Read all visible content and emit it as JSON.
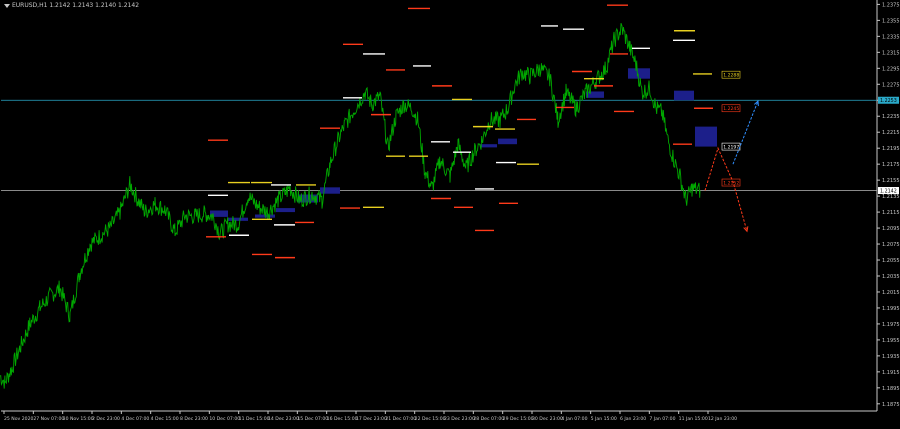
{
  "window": {
    "symbol_header": "EURUSD,H1  1.2142 1.2143 1.2140 1.2142"
  },
  "colors": {
    "background": "#000000",
    "price_line": "#00a800",
    "axis_text": "#c8c8c8",
    "axis_border": "#c8c8c8",
    "hline": "#2aa9c9",
    "zone": "#1c1f8a",
    "level_red": "#ff3a1a",
    "level_white": "#ffffff",
    "level_yellow": "#e8d020",
    "arrow_blue": "#2f8fff",
    "arrow_red": "#ff3030"
  },
  "chart_data": {
    "type": "line",
    "title": "EURUSD,H1",
    "ylim": [
      1.1866,
      1.2378
    ],
    "y_ticks": [
      "1.2375",
      "1.2355",
      "1.2335",
      "1.2315",
      "1.2295",
      "1.2275",
      "1.2255",
      "1.2235",
      "1.2215",
      "1.2195",
      "1.2175",
      "1.2155",
      "1.2135",
      "1.2115",
      "1.2095",
      "1.2075",
      "1.2055",
      "1.2035",
      "1.2015",
      "1.1995",
      "1.1975",
      "1.1955",
      "1.1935",
      "1.1915",
      "1.1895",
      "1.1875"
    ],
    "x_ticks": [
      "25 Nov 2020",
      "27 Nov 07:00",
      "30 Nov 15:00",
      "2 Dec 23:00",
      "4 Dec 07:00",
      "4 Dec 15:00",
      "8 Dec 23:00",
      "10 Dec 07:00",
      "11 Dec 15:00",
      "14 Dec 23:00",
      "15 Dec 07:00",
      "16 Dec 15:00",
      "17 Dec 23:00",
      "21 Dec 07:00",
      "22 Dec 15:00",
      "23 Dec 23:00",
      "28 Dec 07:00",
      "29 Dec 15:00",
      "30 Dec 23:00",
      "4 Jan 07:00",
      "5 Jan 15:00",
      "6 Jan 23:00",
      "7 Jan 07:00",
      "11 Jan 15:00",
      "12 Jan 23:00"
    ],
    "price_keypoints": [
      [
        0,
        1.191
      ],
      [
        5,
        1.1902
      ],
      [
        12,
        1.192
      ],
      [
        20,
        1.1945
      ],
      [
        30,
        1.1975
      ],
      [
        40,
        1.1995
      ],
      [
        50,
        1.201
      ],
      [
        60,
        1.202
      ],
      [
        70,
        1.1985
      ],
      [
        80,
        1.204
      ],
      [
        90,
        1.2075
      ],
      [
        100,
        1.2085
      ],
      [
        110,
        1.2095
      ],
      [
        120,
        1.2115
      ],
      [
        130,
        1.215
      ],
      [
        138,
        1.213
      ],
      [
        145,
        1.2115
      ],
      [
        155,
        1.2125
      ],
      [
        165,
        1.2118
      ],
      [
        175,
        1.209
      ],
      [
        185,
        1.211
      ],
      [
        195,
        1.211
      ],
      [
        205,
        1.2113
      ],
      [
        213,
        1.211
      ],
      [
        220,
        1.2088
      ],
      [
        228,
        1.21
      ],
      [
        238,
        1.21
      ],
      [
        248,
        1.2135
      ],
      [
        258,
        1.2122
      ],
      [
        268,
        1.2115
      ],
      [
        278,
        1.213
      ],
      [
        290,
        1.2145
      ],
      [
        300,
        1.213
      ],
      [
        312,
        1.2138
      ],
      [
        322,
        1.213
      ],
      [
        330,
        1.2175
      ],
      [
        338,
        1.2205
      ],
      [
        345,
        1.2225
      ],
      [
        355,
        1.2245
      ],
      [
        365,
        1.2265
      ],
      [
        372,
        1.225
      ],
      [
        380,
        1.226
      ],
      [
        388,
        1.2195
      ],
      [
        396,
        1.2235
      ],
      [
        404,
        1.225
      ],
      [
        412,
        1.2245
      ],
      [
        418,
        1.223
      ],
      [
        425,
        1.2165
      ],
      [
        432,
        1.2145
      ],
      [
        440,
        1.218
      ],
      [
        450,
        1.216
      ],
      [
        458,
        1.22
      ],
      [
        466,
        1.217
      ],
      [
        474,
        1.219
      ],
      [
        482,
        1.2205
      ],
      [
        490,
        1.223
      ],
      [
        500,
        1.223
      ],
      [
        508,
        1.2245
      ],
      [
        515,
        1.2275
      ],
      [
        522,
        1.229
      ],
      [
        530,
        1.2285
      ],
      [
        540,
        1.2295
      ],
      [
        550,
        1.2283
      ],
      [
        558,
        1.223
      ],
      [
        566,
        1.2265
      ],
      [
        576,
        1.2245
      ],
      [
        586,
        1.2265
      ],
      [
        596,
        1.228
      ],
      [
        606,
        1.2295
      ],
      [
        614,
        1.233
      ],
      [
        622,
        1.2345
      ],
      [
        630,
        1.232
      ],
      [
        636,
        1.23
      ],
      [
        642,
        1.2265
      ],
      [
        650,
        1.227
      ],
      [
        656,
        1.2245
      ],
      [
        662,
        1.224
      ],
      [
        668,
        1.2205
      ],
      [
        674,
        1.218
      ],
      [
        680,
        1.216
      ],
      [
        686,
        1.213
      ],
      [
        692,
        1.2145
      ],
      [
        700,
        1.2142
      ]
    ],
    "h_lines": [
      1.2255,
      1.2142
    ],
    "zones": [
      {
        "x0": 210,
        "x1": 228,
        "y0": 1.2117,
        "y1": 1.2109
      },
      {
        "x0": 228,
        "x1": 248,
        "y0": 1.2108,
        "y1": 1.2104
      },
      {
        "x0": 255,
        "x1": 275,
        "y0": 1.2112,
        "y1": 1.2108
      },
      {
        "x0": 276,
        "x1": 295,
        "y0": 1.212,
        "y1": 1.2115
      },
      {
        "x0": 298,
        "x1": 318,
        "y0": 1.2137,
        "y1": 1.2127
      },
      {
        "x0": 320,
        "x1": 340,
        "y0": 1.2146,
        "y1": 1.2138
      },
      {
        "x0": 480,
        "x1": 497,
        "y0": 1.22,
        "y1": 1.2196
      },
      {
        "x0": 498,
        "x1": 517,
        "y0": 1.2207,
        "y1": 1.22
      },
      {
        "x0": 586,
        "x1": 604,
        "y0": 1.2266,
        "y1": 1.2258
      },
      {
        "x0": 628,
        "x1": 650,
        "y0": 1.2295,
        "y1": 1.2282
      },
      {
        "x0": 674,
        "x1": 694,
        "y0": 1.2267,
        "y1": 1.2255
      },
      {
        "x0": 695,
        "x1": 717,
        "y0": 1.2222,
        "y1": 1.2197
      }
    ],
    "levels": [
      {
        "x0": 408,
        "x1": 430,
        "y": 1.237,
        "c": "red"
      },
      {
        "x0": 607,
        "x1": 628,
        "y": 1.2374,
        "c": "red"
      },
      {
        "x0": 541,
        "x1": 558,
        "y": 1.2348,
        "c": "white"
      },
      {
        "x0": 563,
        "x1": 584,
        "y": 1.2344,
        "c": "white"
      },
      {
        "x0": 674,
        "x1": 695,
        "y": 1.2342,
        "c": "yellow"
      },
      {
        "x0": 673,
        "x1": 695,
        "y": 1.233,
        "c": "white"
      },
      {
        "x0": 343,
        "x1": 363,
        "y": 1.2325,
        "c": "red"
      },
      {
        "x0": 363,
        "x1": 385,
        "y": 1.2313,
        "c": "white"
      },
      {
        "x0": 632,
        "x1": 650,
        "y": 1.232,
        "c": "white"
      },
      {
        "x0": 610,
        "x1": 628,
        "y": 1.2313,
        "c": "red"
      },
      {
        "x0": 572,
        "x1": 592,
        "y": 1.2291,
        "c": "red"
      },
      {
        "x0": 413,
        "x1": 431,
        "y": 1.2298,
        "c": "white"
      },
      {
        "x0": 386,
        "x1": 405,
        "y": 1.2293,
        "c": "red"
      },
      {
        "x0": 584,
        "x1": 604,
        "y": 1.2282,
        "c": "yellow"
      },
      {
        "x0": 693,
        "x1": 712,
        "y": 1.2288,
        "c": "yellow"
      },
      {
        "x0": 432,
        "x1": 452,
        "y": 1.2273,
        "c": "red"
      },
      {
        "x0": 594,
        "x1": 613,
        "y": 1.2273,
        "c": "red"
      },
      {
        "x0": 343,
        "x1": 362,
        "y": 1.2258,
        "c": "white"
      },
      {
        "x0": 452,
        "x1": 472,
        "y": 1.2256,
        "c": "yellow"
      },
      {
        "x0": 556,
        "x1": 574,
        "y": 1.2246,
        "c": "red"
      },
      {
        "x0": 614,
        "x1": 634,
        "y": 1.2241,
        "c": "red"
      },
      {
        "x0": 694,
        "x1": 713,
        "y": 1.2245,
        "c": "red"
      },
      {
        "x0": 371,
        "x1": 391,
        "y": 1.2237,
        "c": "red"
      },
      {
        "x0": 517,
        "x1": 536,
        "y": 1.2231,
        "c": "red"
      },
      {
        "x0": 320,
        "x1": 340,
        "y": 1.222,
        "c": "red"
      },
      {
        "x0": 473,
        "x1": 493,
        "y": 1.2222,
        "c": "yellow"
      },
      {
        "x0": 495,
        "x1": 515,
        "y": 1.2219,
        "c": "yellow"
      },
      {
        "x0": 208,
        "x1": 228,
        "y": 1.2205,
        "c": "red"
      },
      {
        "x0": 431,
        "x1": 450,
        "y": 1.2203,
        "c": "white"
      },
      {
        "x0": 453,
        "x1": 471,
        "y": 1.219,
        "c": "white"
      },
      {
        "x0": 386,
        "x1": 405,
        "y": 1.2185,
        "c": "yellow"
      },
      {
        "x0": 409,
        "x1": 428,
        "y": 1.2185,
        "c": "yellow"
      },
      {
        "x0": 496,
        "x1": 516,
        "y": 1.2177,
        "c": "white"
      },
      {
        "x0": 517,
        "x1": 539,
        "y": 1.2175,
        "c": "yellow"
      },
      {
        "x0": 673,
        "x1": 692,
        "y": 1.22,
        "c": "red"
      },
      {
        "x0": 228,
        "x1": 250,
        "y": 1.2152,
        "c": "yellow"
      },
      {
        "x0": 251,
        "x1": 272,
        "y": 1.2152,
        "c": "yellow"
      },
      {
        "x0": 271,
        "x1": 291,
        "y": 1.2149,
        "c": "white"
      },
      {
        "x0": 296,
        "x1": 316,
        "y": 1.2149,
        "c": "yellow"
      },
      {
        "x0": 475,
        "x1": 494,
        "y": 1.2144,
        "c": "white"
      },
      {
        "x0": 208,
        "x1": 228,
        "y": 1.2136,
        "c": "white"
      },
      {
        "x0": 431,
        "x1": 451,
        "y": 1.2132,
        "c": "red"
      },
      {
        "x0": 499,
        "x1": 518,
        "y": 1.2126,
        "c": "red"
      },
      {
        "x0": 363,
        "x1": 384,
        "y": 1.2121,
        "c": "yellow"
      },
      {
        "x0": 340,
        "x1": 360,
        "y": 1.212,
        "c": "red"
      },
      {
        "x0": 454,
        "x1": 473,
        "y": 1.2121,
        "c": "red"
      },
      {
        "x0": 252,
        "x1": 272,
        "y": 1.2106,
        "c": "yellow"
      },
      {
        "x0": 295,
        "x1": 314,
        "y": 1.2102,
        "c": "red"
      },
      {
        "x0": 274,
        "x1": 295,
        "y": 1.2099,
        "c": "white"
      },
      {
        "x0": 475,
        "x1": 494,
        "y": 1.2092,
        "c": "red"
      },
      {
        "x0": 229,
        "x1": 249,
        "y": 1.2086,
        "c": "white"
      },
      {
        "x0": 206,
        "x1": 226,
        "y": 1.2084,
        "c": "red"
      },
      {
        "x0": 252,
        "x1": 272,
        "y": 1.2062,
        "c": "red"
      },
      {
        "x0": 275,
        "x1": 295,
        "y": 1.2058,
        "c": "red"
      }
    ],
    "level_labels": [
      {
        "x": 722,
        "y": 1.2287,
        "text": "1.2288",
        "c": "yellow"
      },
      {
        "x": 722,
        "y": 1.2245,
        "text": "1.2245",
        "c": "red"
      },
      {
        "x": 722,
        "y": 1.2197,
        "text": "1.2197",
        "c": "white"
      },
      {
        "x": 722,
        "y": 1.2152,
        "text": "1.2152",
        "c": "red"
      }
    ],
    "price_tags": [
      {
        "y": 1.2255,
        "text": "1.2253",
        "c": "hline"
      },
      {
        "y": 1.2142,
        "text": "1.2142",
        "c": "white"
      }
    ],
    "arrows": [
      {
        "pts": [
          [
            705,
            1.2142
          ],
          [
            718,
            1.2195
          ],
          [
            733,
            1.2153
          ],
          [
            747,
            1.2091
          ]
        ],
        "c": "red"
      },
      {
        "pts": [
          [
            733,
            1.2175
          ],
          [
            758,
            1.2254
          ]
        ],
        "c": "blue"
      }
    ]
  }
}
